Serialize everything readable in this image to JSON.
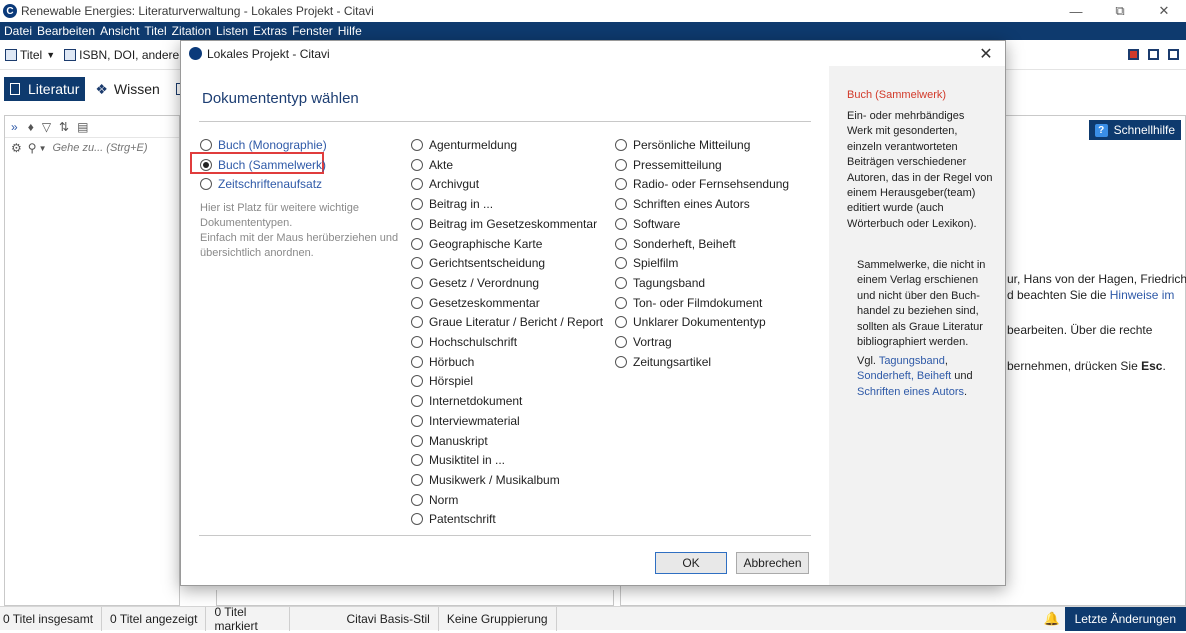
{
  "window": {
    "title": "Renewable Energies: Literaturverwaltung - Lokales Projekt - Citavi"
  },
  "menu": [
    "Datei",
    "Bearbeiten",
    "Ansicht",
    "Titel",
    "Zitation",
    "Listen",
    "Extras",
    "Fenster",
    "Hilfe"
  ],
  "toolbar": {
    "title_label": "Titel",
    "isbn_label": "ISBN, DOI, andere ID"
  },
  "nav_tabs": {
    "literature": "Literatur",
    "knowledge": "Wissen"
  },
  "left_panel": {
    "goto_placeholder": "Gehe zu... (Strg+E)"
  },
  "right_panel": {
    "quickhelp": "Schnellhilfe",
    "bg_line1": "ur, Hans von der Hagen, Friedrich",
    "bg_line2_pre": "d beachten Sie die ",
    "bg_line2_link": "Hinweise im",
    "bg_line3": "bearbeiten. Über die rechte",
    "bg_line4_pre": "bernehmen, drücken Sie ",
    "bg_line4_key": "Esc",
    "bg_line4_post": "."
  },
  "status": {
    "total": "0 Titel insgesamt",
    "shown": "0 Titel angezeigt",
    "marked": "0 Titel markiert",
    "style": "Citavi Basis-Stil",
    "grouping": "Keine Gruppierung",
    "latest": "Letzte Änderungen"
  },
  "dialog": {
    "title": "Lokales Projekt - Citavi",
    "heading": "Dokumententyp wählen",
    "favorites": [
      "Buch (Monographie)",
      "Buch (Sammelwerk)",
      "Zeitschriftenaufsatz"
    ],
    "selected": "Buch (Sammelwerk)",
    "hint": "Hier ist Platz für weitere wichtige Dokumententypen.\nEinfach mit der Maus herüberziehen und übersichtlich anordnen.",
    "col2": [
      "Agenturmeldung",
      "Akte",
      "Archivgut",
      "Beitrag in ...",
      "Beitrag im Gesetzeskommentar",
      "Geographische Karte",
      "Gerichtsentscheidung",
      "Gesetz / Verordnung",
      "Gesetzeskommentar",
      "Graue Literatur / Bericht / Report",
      "Hochschulschrift",
      "Hörbuch",
      "Hörspiel",
      "Internetdokument",
      "Interviewmaterial",
      "Manuskript",
      "Musiktitel in ...",
      "Musikwerk / Musikalbum",
      "Norm",
      "Patentschrift"
    ],
    "col3": [
      "Persönliche Mitteilung",
      "Pressemitteilung",
      "Radio- oder Fernsehsendung",
      "Schriften eines Autors",
      "Software",
      "Sonderheft, Beiheft",
      "Spielfilm",
      "Tagungsband",
      "Ton- oder Filmdokument",
      "Unklarer Dokumententyp",
      "Vortrag",
      "Zeitungsartikel"
    ],
    "ok": "OK",
    "cancel": "Abbrechen",
    "desc_title": "Buch (Sammelwerk)",
    "desc_lines": [
      "Ein- oder mehrbändiges",
      "Werk mit gesonderten,",
      "einzeln verantworteten",
      "Beiträgen verschiedener",
      "Autoren, das in der Regel von",
      "einem Herausgeber(team)",
      "editiert wurde (auch",
      "Wörterbuch oder Lexikon)."
    ],
    "note_lines": [
      "Sammelwerke, die nicht in",
      "einem Verlag erschienen",
      "und nicht über den Buch-",
      "handel zu beziehen sind,",
      "sollten als Graue Literatur",
      "bibliographiert werden."
    ],
    "cf_prefix": "Vgl. ",
    "cf_link1": "Tagungsband",
    "cf_sep": ",",
    "cf_link2": "Sonderheft, Beiheft",
    "cf_and": " und",
    "cf_link3": "Schriften eines Autors",
    "cf_end": "."
  }
}
